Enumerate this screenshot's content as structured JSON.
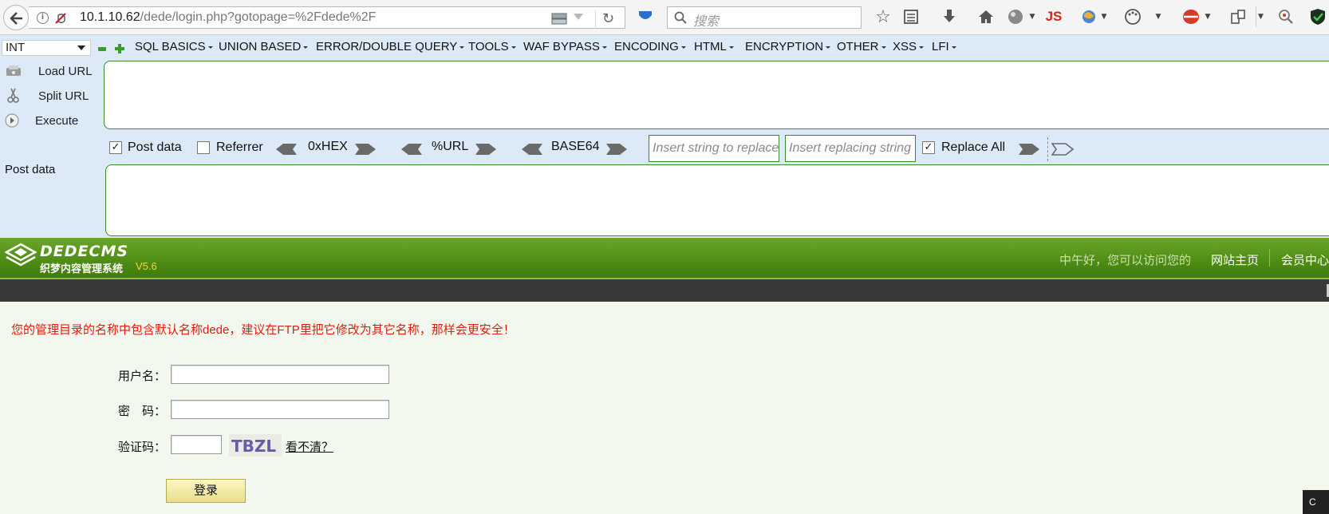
{
  "browser": {
    "url_host": "10.1.10.62",
    "url_path": "/dede/login.php?gotopage=%2Fdede%2F",
    "search_placeholder": "搜索",
    "js_badge": "JS"
  },
  "hackbar": {
    "type_select": "INT",
    "menus": [
      "SQL BASICS",
      "UNION BASED",
      "ERROR/DOUBLE QUERY",
      "TOOLS",
      "WAF BYPASS",
      "ENCODING",
      "HTML",
      "ENCRYPTION",
      "OTHER",
      "XSS",
      "LFI"
    ],
    "actions": {
      "load": "Load URL",
      "split": "Split URL",
      "execute": "Execute"
    },
    "options": {
      "post_data": "Post data",
      "referrer": "Referrer",
      "hex": "0xHEX",
      "url": "%URL",
      "base64": "BASE64",
      "replace_placeholder": "Insert string to replace",
      "replacing_placeholder": "Insert replacing string",
      "replace_all": "Replace All"
    },
    "post_data_label": "Post data",
    "post_data_checked": true,
    "referrer_checked": false,
    "replace_all_checked": true
  },
  "dede": {
    "logo": "DEDECMS",
    "logo_sub": "织梦内容管理系统",
    "version": "V5.6",
    "greeting": "中午好，您可以访问您的",
    "links": [
      "网站主页",
      "会员中心"
    ],
    "warning": "您的管理目录的名称中包含默认名称dede，建议在FTP里把它修改为其它名称，那样会更安全！",
    "form": {
      "username_label": "用户名：",
      "password_label": "密　码：",
      "captcha_label": "验证码：",
      "captcha_text": "TBZL",
      "captcha_refresh": "看不清？",
      "submit": "登录"
    }
  },
  "taskbar_tag": "C"
}
